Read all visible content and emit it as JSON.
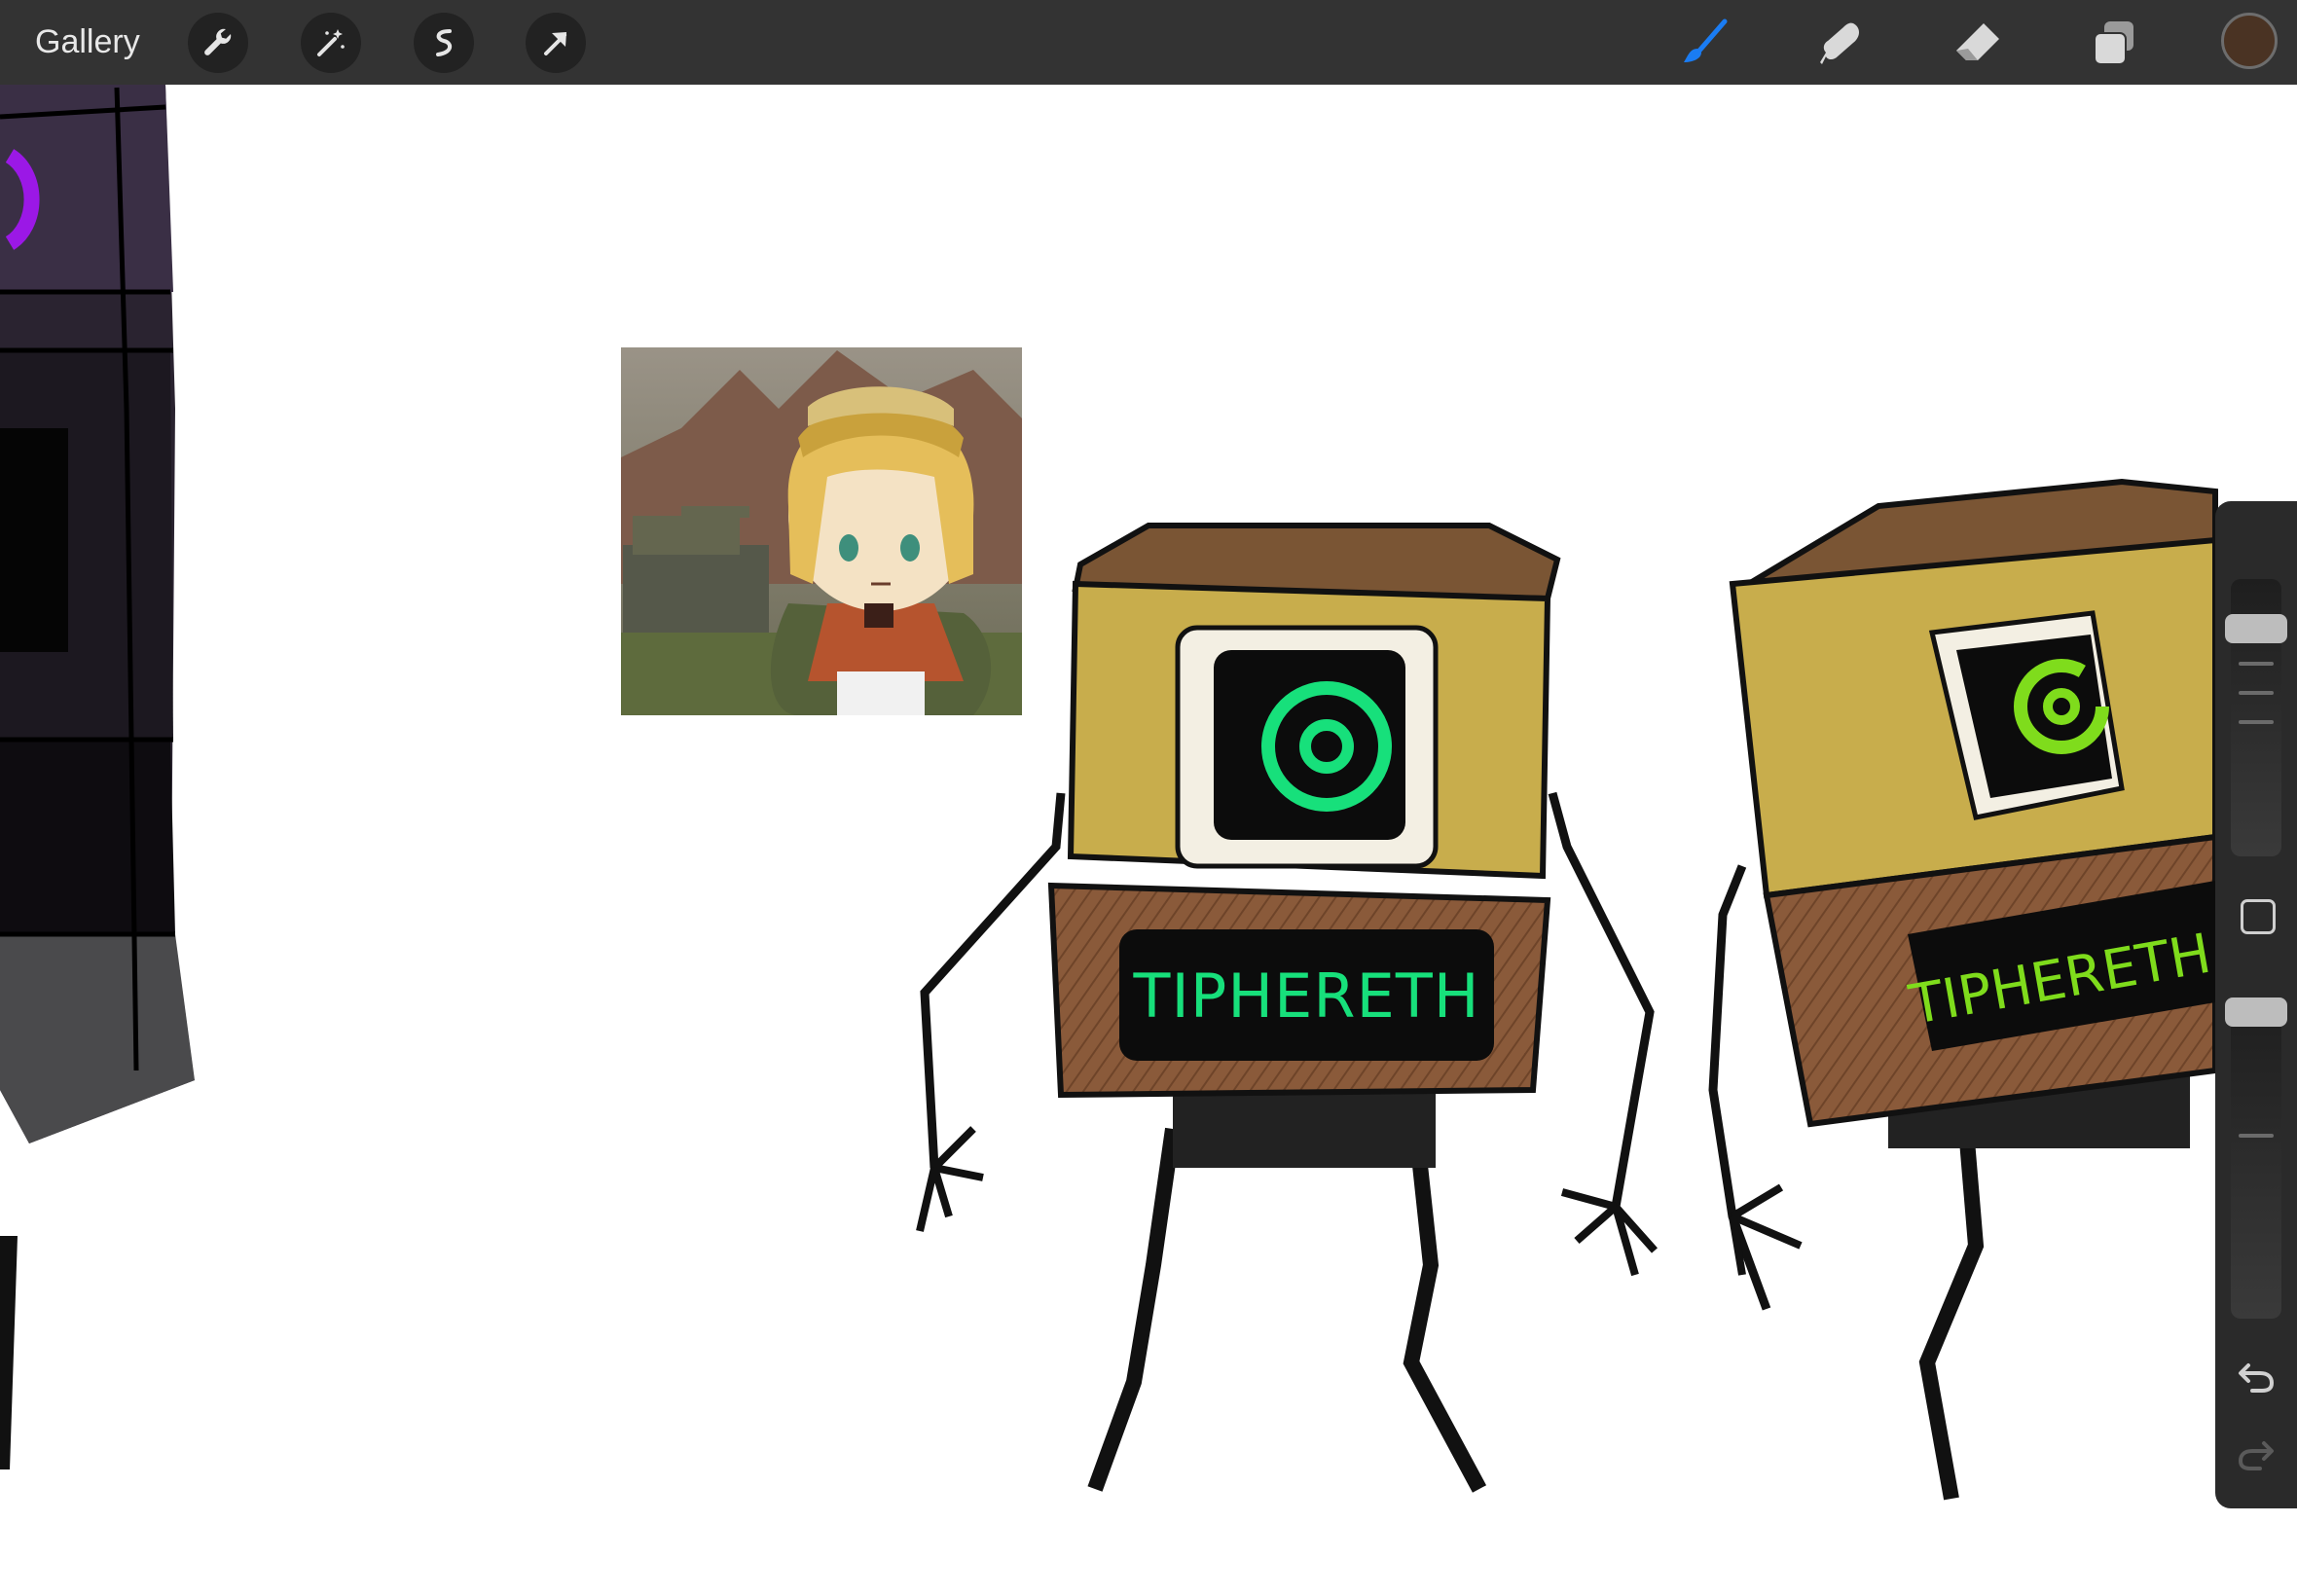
{
  "toolbar": {
    "gallery_label": "Gallery",
    "left_tools": [
      "wrench-icon",
      "magic-wand-icon",
      "selection-icon",
      "transform-arrow-icon"
    ],
    "right_tools": [
      "brush-icon",
      "smudge-icon",
      "eraser-icon",
      "layers-icon"
    ],
    "active_tool": "brush",
    "active_color": "#4a3323",
    "accent_color": "#1a7cf3"
  },
  "canvas": {
    "robot_label_1": "TIPHERETH",
    "robot_label_2": "TIPHERETH",
    "screen_color": "#17e07b",
    "screen_color_2": "#7fdc1c",
    "body_colors": {
      "top": "#7a5534",
      "panel": "#c8ad4c",
      "lower": "#8a5a3a"
    }
  },
  "sidebar": {
    "brush_size_level": 0.14,
    "opacity_level": 0.0,
    "icons": [
      "modify-square-icon",
      "undo-icon",
      "redo-icon"
    ]
  }
}
